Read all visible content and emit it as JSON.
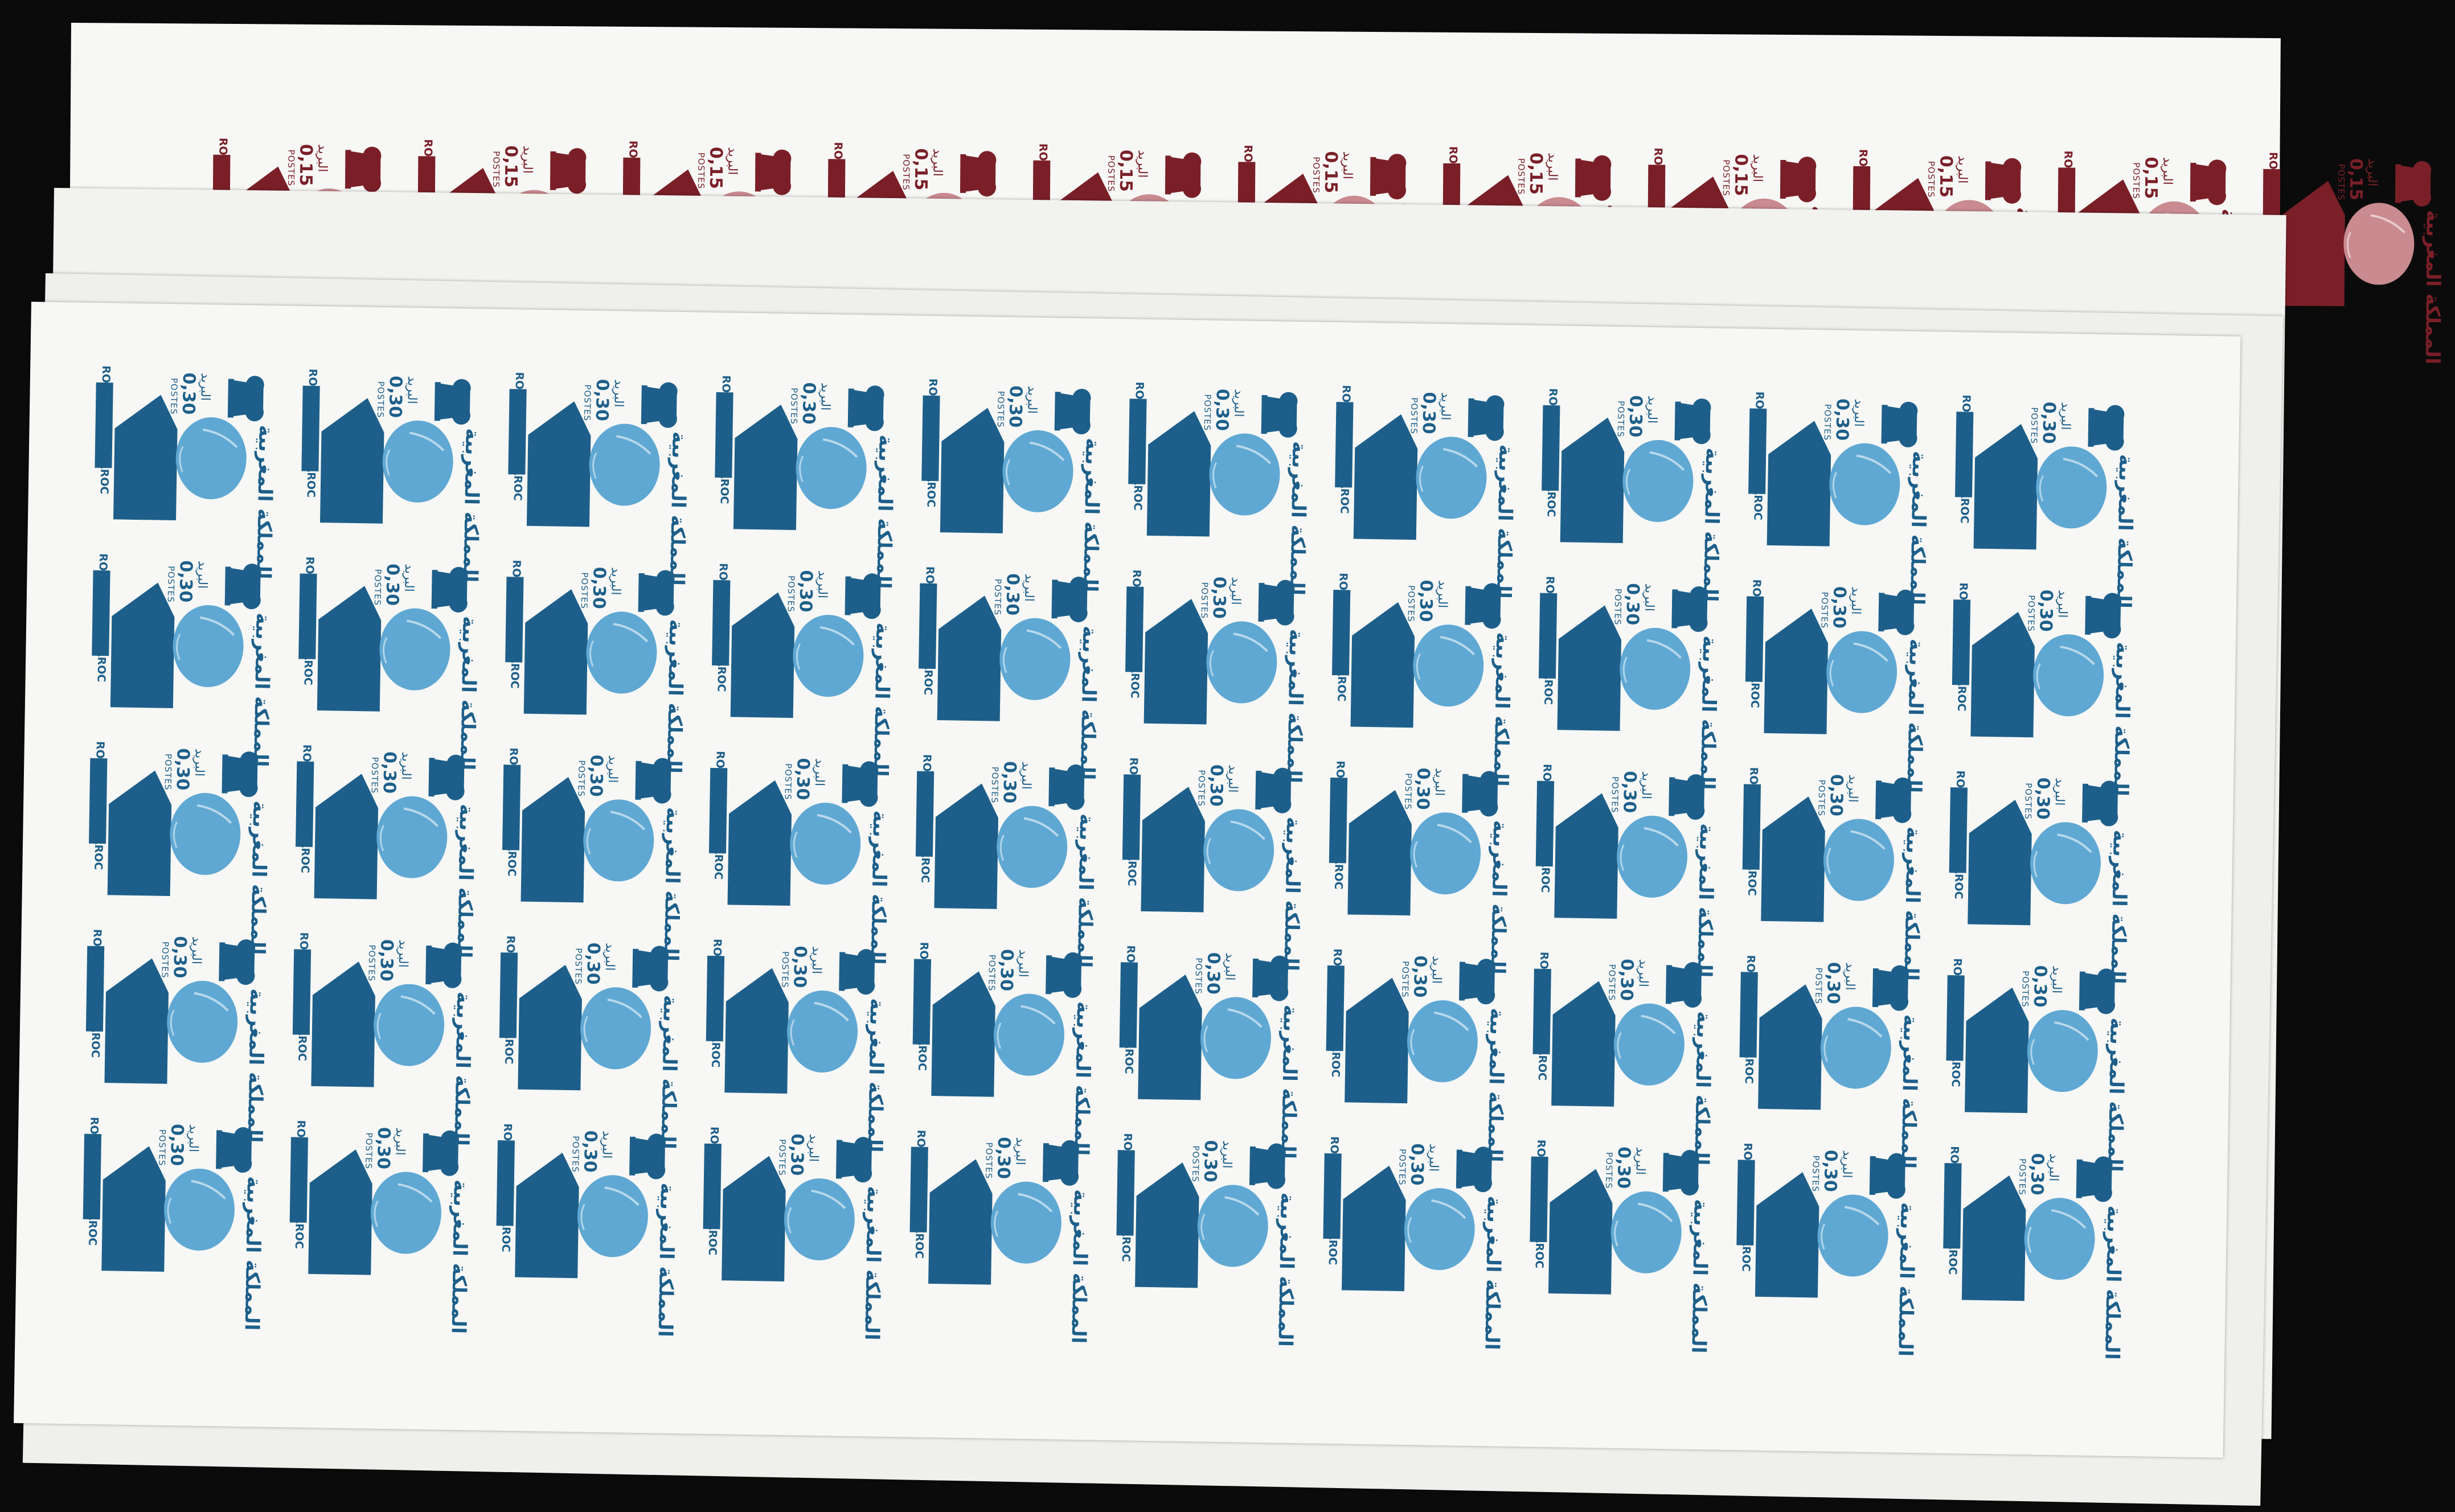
{
  "colors": {
    "background": "#0b0b0b",
    "paper": "#f7f7f5",
    "blue_ink": "#1d5f8a",
    "blue_portrait": "#5fa8d3",
    "maroon_ink": "#7a1f28",
    "maroon_portrait": "#c98a90"
  },
  "stamps": {
    "blue": {
      "value": "0,30",
      "postes": "POSTES",
      "country_fr": "ROYAUME DU MAROC",
      "country_ar": "المملكة المغربية",
      "postes_ar": "البريد",
      "icon": "crown-icon",
      "portrait": "portrait-icon",
      "rows": 5,
      "columns": 10
    },
    "maroon": {
      "value": "0,15",
      "postes": "POSTES",
      "country_fr": "ROYAUME DU MAROC",
      "country_ar": "المملكة المغربية",
      "postes_ar": "البريد",
      "icon": "crown-icon",
      "portrait": "portrait-icon",
      "rows": 1,
      "columns": 11
    }
  }
}
